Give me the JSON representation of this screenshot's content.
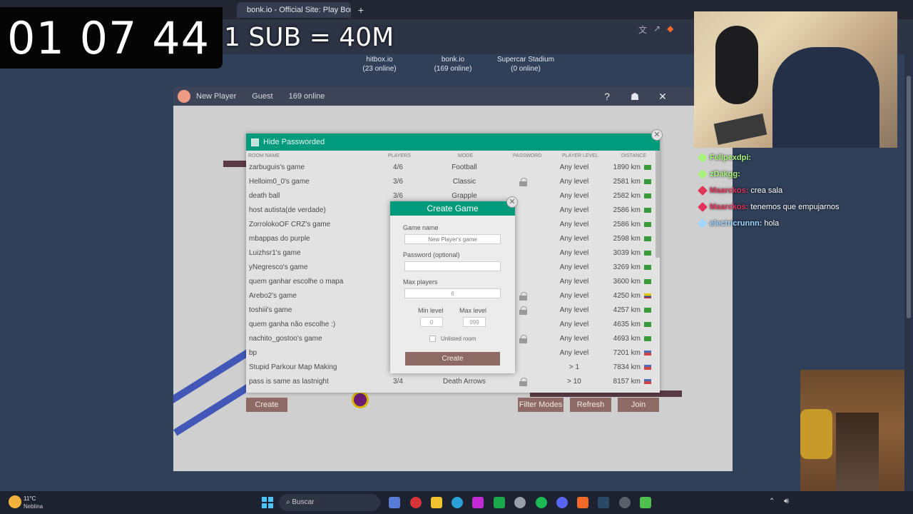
{
  "browser": {
    "tabs": [
      {
        "label": "bonk.io - Official Site: Play Bonk"
      },
      {
        "label": "+"
      }
    ],
    "url_fragment": "atestr"
  },
  "overlay": {
    "timer": "01 07 44",
    "sub_goal": "1 SUB = 40M"
  },
  "servers": [
    {
      "name": "hitbox.io",
      "online": "(23 online)"
    },
    {
      "name": "bonk.io",
      "online": "(169 online)"
    },
    {
      "name": "Supercar Stadium",
      "online": "(0 online)"
    }
  ],
  "game_bar": {
    "player_name": "New Player",
    "account": "Guest",
    "online": "169 online"
  },
  "room_list": {
    "hide_passworded": "Hide Passworded",
    "close": "✕",
    "columns": {
      "room_name": "ROOM NAME",
      "players": "PLAYERS",
      "mode": "MODE",
      "password": "PASSWORD",
      "player_level": "PLAYER LEVEL",
      "distance": "DISTANCE"
    },
    "rows": [
      {
        "name": "zarbuguis's game",
        "players": "4/6",
        "mode": "Football",
        "locked": false,
        "level": "Any level",
        "distance": "1890 km",
        "flag": "br"
      },
      {
        "name": "Helloim0_0's game",
        "players": "3/6",
        "mode": "Classic",
        "locked": true,
        "level": "Any level",
        "distance": "2581 km",
        "flag": "br"
      },
      {
        "name": "death ball",
        "players": "3/6",
        "mode": "Grapple",
        "locked": false,
        "level": "Any level",
        "distance": "2582 km",
        "flag": "br"
      },
      {
        "name": "host autista(de verdade)",
        "players": "",
        "mode": "",
        "locked": false,
        "level": "Any level",
        "distance": "2586 km",
        "flag": "br"
      },
      {
        "name": "ZorrolokoOF CRZ's game",
        "players": "",
        "mode": "",
        "locked": false,
        "level": "Any level",
        "distance": "2586 km",
        "flag": "br"
      },
      {
        "name": "mbappas do purple",
        "players": "",
        "mode": "",
        "locked": false,
        "level": "Any level",
        "distance": "2598 km",
        "flag": "br"
      },
      {
        "name": "Luizhsr1's game",
        "players": "",
        "mode": "",
        "locked": false,
        "level": "Any level",
        "distance": "3039 km",
        "flag": "br"
      },
      {
        "name": "yNegresco's game",
        "players": "",
        "mode": "",
        "locked": false,
        "level": "Any level",
        "distance": "3269 km",
        "flag": "br"
      },
      {
        "name": "quem ganhar escolhe o mapa",
        "players": "",
        "mode": "",
        "locked": false,
        "level": "Any level",
        "distance": "3600 km",
        "flag": "br"
      },
      {
        "name": "Arebo2's game",
        "players": "",
        "mode": "",
        "locked": true,
        "level": "Any level",
        "distance": "4250 km",
        "flag": "co"
      },
      {
        "name": "toshiii's game",
        "players": "",
        "mode": "",
        "locked": true,
        "level": "Any level",
        "distance": "4257 km",
        "flag": "br"
      },
      {
        "name": "quem ganha não escolhe :)",
        "players": "",
        "mode": "",
        "locked": false,
        "level": "Any level",
        "distance": "4635 km",
        "flag": "br"
      },
      {
        "name": "nachito_gostoo's game",
        "players": "",
        "mode": "",
        "locked": true,
        "level": "Any level",
        "distance": "4693 km",
        "flag": "br"
      },
      {
        "name": "bp",
        "players": "",
        "mode": "",
        "locked": false,
        "level": "Any level",
        "distance": "7201 km",
        "flag": "us"
      },
      {
        "name": "Stupid Parkour Map Making",
        "players": "",
        "mode": "",
        "locked": false,
        "level": "> 1",
        "distance": "7834 km",
        "flag": "us"
      },
      {
        "name": "pass is same as lastnight",
        "players": "3/4",
        "mode": "Death Arrows",
        "locked": true,
        "level": "> 10",
        "distance": "8157 km",
        "flag": "us"
      }
    ],
    "buttons": {
      "create": "Create",
      "filter_modes": "Filter Modes",
      "refresh": "Refresh",
      "join": "Join"
    }
  },
  "create_game": {
    "title": "Create Game",
    "close": "✕",
    "game_name_label": "Game name",
    "game_name_placeholder": "New Player's game",
    "password_label": "Password (optional)",
    "max_players_label": "Max players",
    "max_players_value": "6",
    "min_level_label": "Min level",
    "min_level_value": "0",
    "max_level_label": "Max level",
    "max_level_value": "999",
    "unlisted_label": "Unlisted room",
    "create_button": "Create"
  },
  "chat": [
    {
      "user": "Felipexdpi:",
      "message": "",
      "color": "#a9f27a"
    },
    {
      "user": "zDakgg:",
      "message": "",
      "color": "#a9f27a"
    },
    {
      "user": "Maarckos:",
      "message": "crea sala",
      "color": "#e2335b"
    },
    {
      "user": "Maarckos:",
      "message": "tenemos que empujarnos",
      "color": "#e2335b"
    },
    {
      "user": "electricrunnn:",
      "message": "hola",
      "color": "#9fd5ff"
    }
  ],
  "taskbar": {
    "weather_temp": "11°C",
    "weather_desc": "Neblina",
    "search_label": "Buscar"
  },
  "colors": {
    "accent": "#009b7d",
    "button": "#8d6b64",
    "page_bg": "#304059"
  }
}
